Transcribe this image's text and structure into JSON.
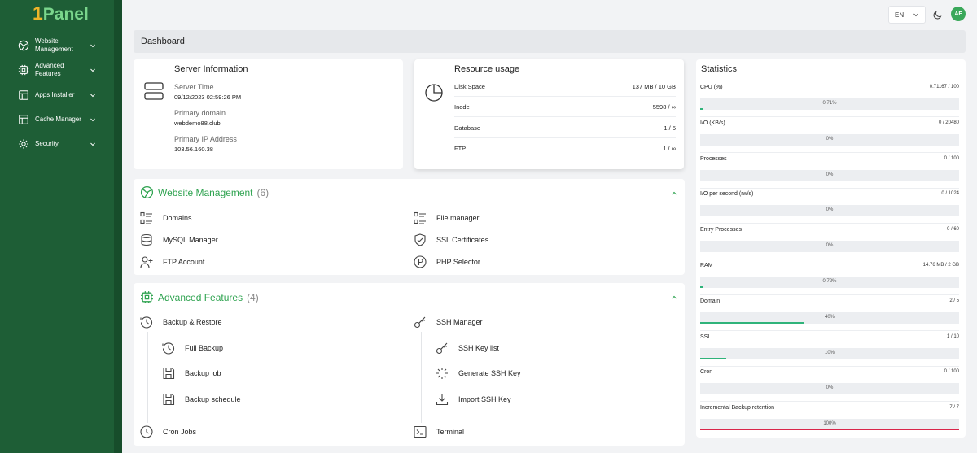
{
  "brand": {
    "logo_one": "1",
    "logo_text": "Panel"
  },
  "sidebar": {
    "items": [
      {
        "label": "Website Management",
        "icon": "globe-icon"
      },
      {
        "label": "Advanced Features",
        "icon": "chip-icon"
      },
      {
        "label": "Apps Installer",
        "icon": "apps-icon"
      },
      {
        "label": "Cache Manager",
        "icon": "cache-icon"
      },
      {
        "label": "Security",
        "icon": "gear-icon"
      }
    ]
  },
  "topbar": {
    "lang": "EN",
    "avatar": "AF"
  },
  "breadcrumb": "Dashboard",
  "server": {
    "title": "Server Information",
    "time_label": "Server Time",
    "time_value": "09/12/2023 02:59:26 PM",
    "domain_label": "Primary domain",
    "domain_value": "webdemo88.club",
    "ip_label": "Primary IP Address",
    "ip_value": "103.56.160.38"
  },
  "resource": {
    "title": "Resource usage",
    "rows": [
      {
        "label": "Disk Space",
        "value": "137 MB / 10 GB"
      },
      {
        "label": "Inode",
        "value": "5598 / ∞"
      },
      {
        "label": "Database",
        "value": "1 / 5"
      },
      {
        "label": "FTP",
        "value": "1 / ∞"
      }
    ]
  },
  "website": {
    "title": "Website Management",
    "count": "(6)",
    "items": [
      "Domains",
      "File manager",
      "MySQL Manager",
      "SSL Certificates",
      "FTP Account",
      "PHP Selector"
    ]
  },
  "advanced": {
    "title": "Advanced Features",
    "count": "(4)",
    "backup": "Backup & Restore",
    "full_backup": "Full Backup",
    "backup_job": "Backup job",
    "backup_schedule": "Backup schedule",
    "ssh": "SSH Manager",
    "ssh_key_list": "SSH Key list",
    "gen_ssh": "Generate SSH Key",
    "import_ssh": "Import SSH Key",
    "cron": "Cron Jobs",
    "terminal": "Terminal"
  },
  "statistics": {
    "title": "Statistics",
    "rows": [
      {
        "name": "CPU (%)",
        "value": "0.71167 / 100",
        "pct": "0.71%",
        "fraction": 0.0071,
        "color": "#2fb37a"
      },
      {
        "name": "I/O (KB/s)",
        "value": "0 / 20480",
        "pct": "0%",
        "fraction": 0,
        "color": "#2fb37a"
      },
      {
        "name": "Processes",
        "value": "0 / 100",
        "pct": "0%",
        "fraction": 0,
        "color": "#2fb37a"
      },
      {
        "name": "I/O per second (rw/s)",
        "value": "0 / 1024",
        "pct": "0%",
        "fraction": 0,
        "color": "#2fb37a"
      },
      {
        "name": "Entry Processes",
        "value": "0 / 60",
        "pct": "0%",
        "fraction": 0,
        "color": "#2fb37a"
      },
      {
        "name": "RAM",
        "value": "14.76 MB / 2 GB",
        "pct": "0.72%",
        "fraction": 0.0072,
        "color": "#2fb37a"
      },
      {
        "name": "Domain",
        "value": "2 / 5",
        "pct": "40%",
        "fraction": 0.4,
        "color": "#2fb37a"
      },
      {
        "name": "SSL",
        "value": "1 / 10",
        "pct": "10%",
        "fraction": 0.1,
        "color": "#2fb37a"
      },
      {
        "name": "Cron",
        "value": "0 / 100",
        "pct": "0%",
        "fraction": 0,
        "color": "#2fb37a"
      },
      {
        "name": "Incremental Backup retention",
        "value": "7 / 7",
        "pct": "100%",
        "fraction": 1,
        "color": "#d9254a"
      }
    ]
  }
}
